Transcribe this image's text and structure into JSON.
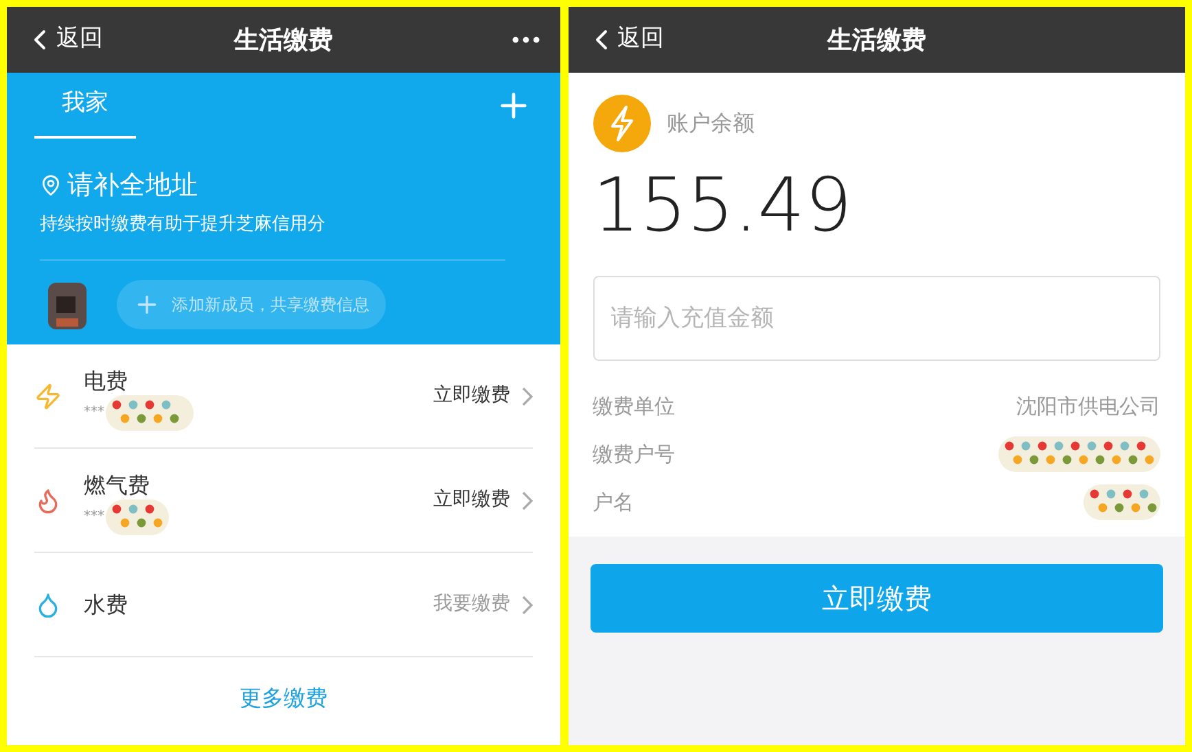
{
  "left": {
    "header": {
      "back": "返回",
      "title": "生活缴费"
    },
    "tabs": [
      {
        "label": "我家",
        "selected": true
      }
    ],
    "address": "请补全地址",
    "hint": "持续按时缴费有助于提升芝麻信用分",
    "add_member": "添加新成员，共享缴费信息",
    "bills": [
      {
        "kind": "electricity",
        "name": "电费",
        "account": "***",
        "redacted": true,
        "action": "立即缴费",
        "active": true
      },
      {
        "kind": "gas",
        "name": "燃气费",
        "account": "***",
        "redacted": true,
        "action": "立即缴费",
        "active": true
      },
      {
        "kind": "water",
        "name": "水费",
        "redacted": false,
        "action": "我要缴费",
        "active": false
      }
    ],
    "more": "更多缴费"
  },
  "right": {
    "header": {
      "back": "返回",
      "title": "生活缴费"
    },
    "balance_label": "账户余额",
    "balance": "155.49",
    "amount_field": {
      "placeholder": "请输入充值金额"
    },
    "details": [
      {
        "label": "缴费单位",
        "value": "沈阳市供电公司",
        "redacted": false
      },
      {
        "label": "缴费户号",
        "redacted": true
      },
      {
        "label": "户名",
        "redacted": true
      }
    ],
    "pay_button": "立即缴费"
  }
}
